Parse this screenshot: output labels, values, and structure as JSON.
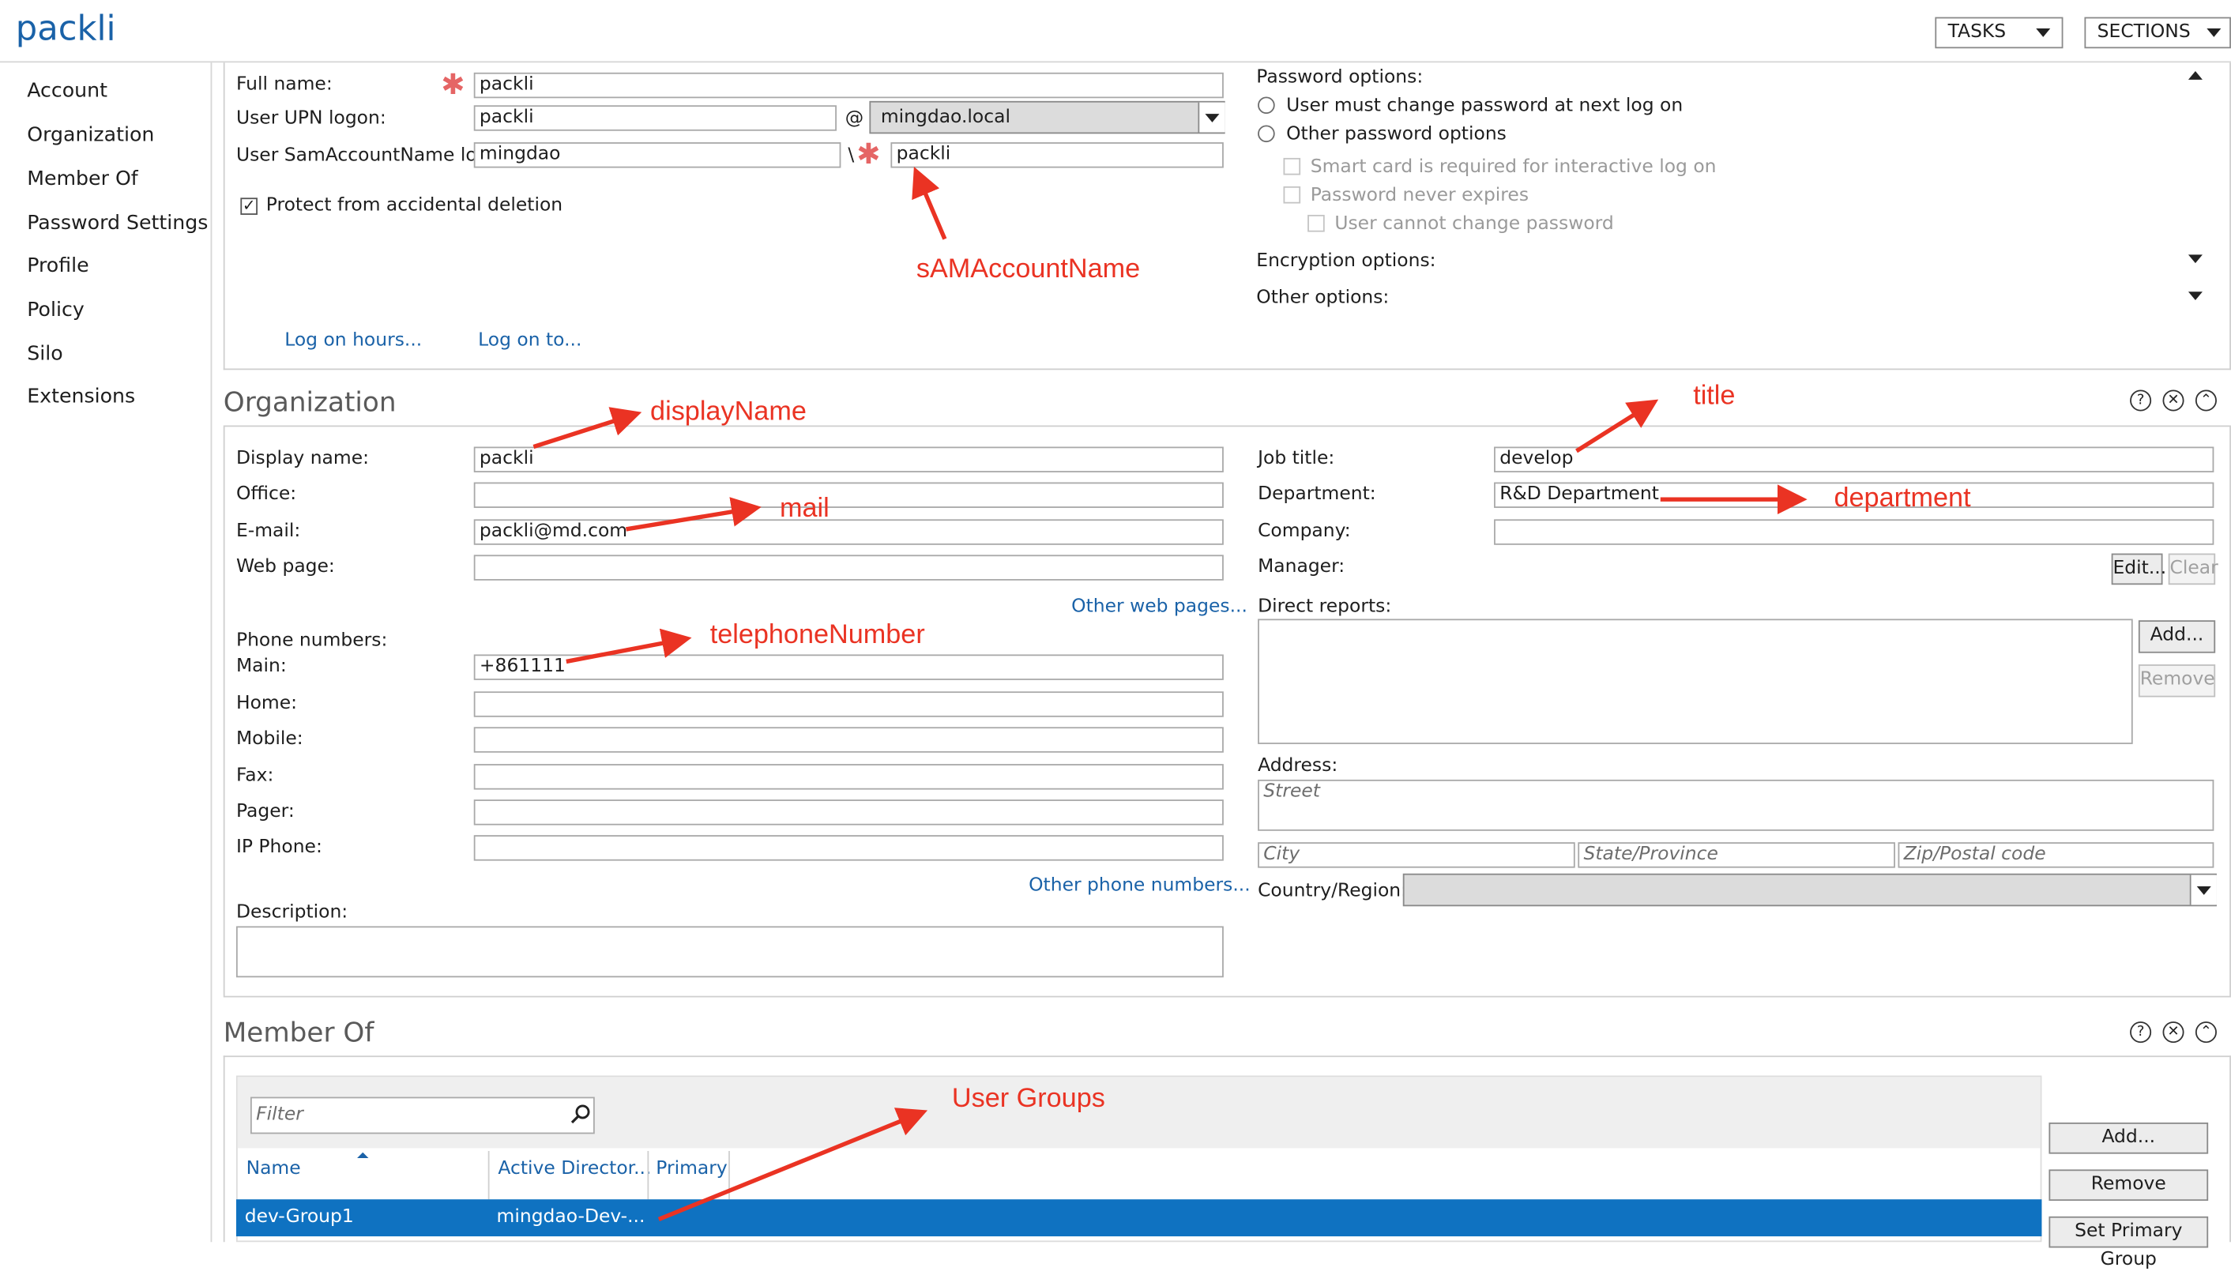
{
  "app": {
    "title": "packli"
  },
  "topbar": {
    "tasks_label": "TASKS",
    "sections_label": "SECTIONS"
  },
  "sidebar": {
    "items": [
      {
        "label": "Account"
      },
      {
        "label": "Organization"
      },
      {
        "label": "Member Of"
      },
      {
        "label": "Password Settings"
      },
      {
        "label": "Profile"
      },
      {
        "label": "Policy"
      },
      {
        "label": "Silo"
      },
      {
        "label": "Extensions"
      }
    ]
  },
  "account": {
    "full_name_label": "Full name:",
    "full_name_value": "packli",
    "upn_label": "User UPN logon:",
    "upn_value": "packli",
    "upn_at": "@",
    "upn_domain": "mingdao.local",
    "sam_label": "User SamAccountName lo...",
    "sam_domain": "mingdao",
    "sam_sep": "\\",
    "sam_value": "packli",
    "protect_label": "Protect from accidental deletion",
    "protect_checked": true,
    "log_on_hours": "Log on hours...",
    "log_on_to": "Log on to...",
    "password_options_label": "Password options:",
    "pw_change_next": "User must change password at next log on",
    "pw_other": "Other password options",
    "pw_smart_card": "Smart card is required for interactive log on",
    "pw_never_expires": "Password never expires",
    "pw_cannot_change": "User cannot change password",
    "encryption_label": "Encryption options:",
    "other_options_label": "Other options:"
  },
  "organization": {
    "title": "Organization",
    "display_name_label": "Display name:",
    "display_name_value": "packli",
    "office_label": "Office:",
    "office_value": "",
    "email_label": "E-mail:",
    "email_value": "packli@md.com",
    "web_label": "Web page:",
    "web_value": "",
    "other_web": "Other web pages...",
    "phone_numbers_label": "Phone numbers:",
    "main_label": "Main:",
    "main_value": "+861111",
    "home_label": "Home:",
    "mobile_label": "Mobile:",
    "fax_label": "Fax:",
    "pager_label": "Pager:",
    "ip_phone_label": "IP Phone:",
    "other_phone": "Other phone numbers...",
    "description_label": "Description:",
    "job_title_label": "Job title:",
    "job_title_value": "develop",
    "department_label": "Department:",
    "department_value": "R&D Department",
    "company_label": "Company:",
    "company_value": "",
    "manager_label": "Manager:",
    "edit_label": "Edit...",
    "clear_label": "Clear",
    "direct_reports_label": "Direct reports:",
    "add_label": "Add...",
    "remove_label": "Remove",
    "address_label": "Address:",
    "street_ph": "Street",
    "city_ph": "City",
    "state_ph": "State/Province",
    "zip_ph": "Zip/Postal code",
    "country_label": "Country/Region:"
  },
  "member_of": {
    "title": "Member Of",
    "filter_ph": "Filter",
    "columns": [
      "Name",
      "Active Director...",
      "Primary"
    ],
    "rows": [
      {
        "name": "dev-Group1",
        "ad": "mingdao-Dev-...",
        "primary": ""
      }
    ],
    "add_label": "Add...",
    "remove_label": "Remove",
    "set_primary_label": "Set Primary Group"
  },
  "annotations": {
    "sam": "sAMAccountName",
    "display_name": "displayName",
    "mail": "mail",
    "telephone": "telephoneNumber",
    "title": "title",
    "department": "department",
    "user_groups": "User Groups"
  },
  "colors": {
    "accent": "#1a62a8",
    "selection": "#0f72c1",
    "annotation": "#ea3323",
    "required": "#e56565"
  }
}
